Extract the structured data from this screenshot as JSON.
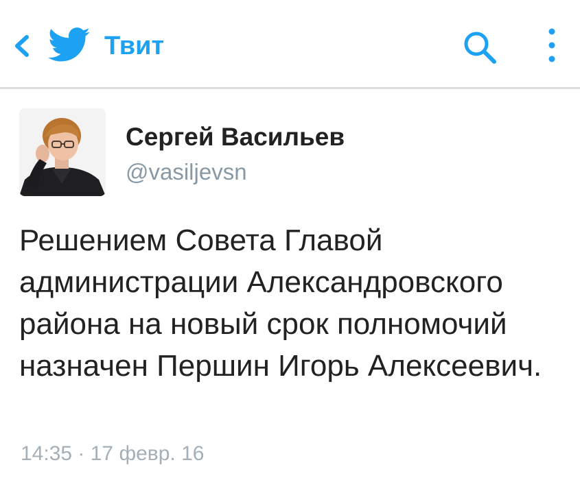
{
  "header": {
    "title": "Твит",
    "back_icon": "chevron-left-icon",
    "logo_icon": "twitter-bird-icon",
    "search_icon": "search-icon",
    "menu_icon": "vertical-dots-icon",
    "accent_color": "#1da1f2"
  },
  "tweet": {
    "author_name": "Сергей Васильев",
    "author_handle": "@vasiljevsn",
    "text": "Решением Совета Главой администрации Александровского района на новый срок полномочий назначен Першин Игорь Алексеевич.",
    "timestamp": "14:35 · 17 февр. 16"
  }
}
